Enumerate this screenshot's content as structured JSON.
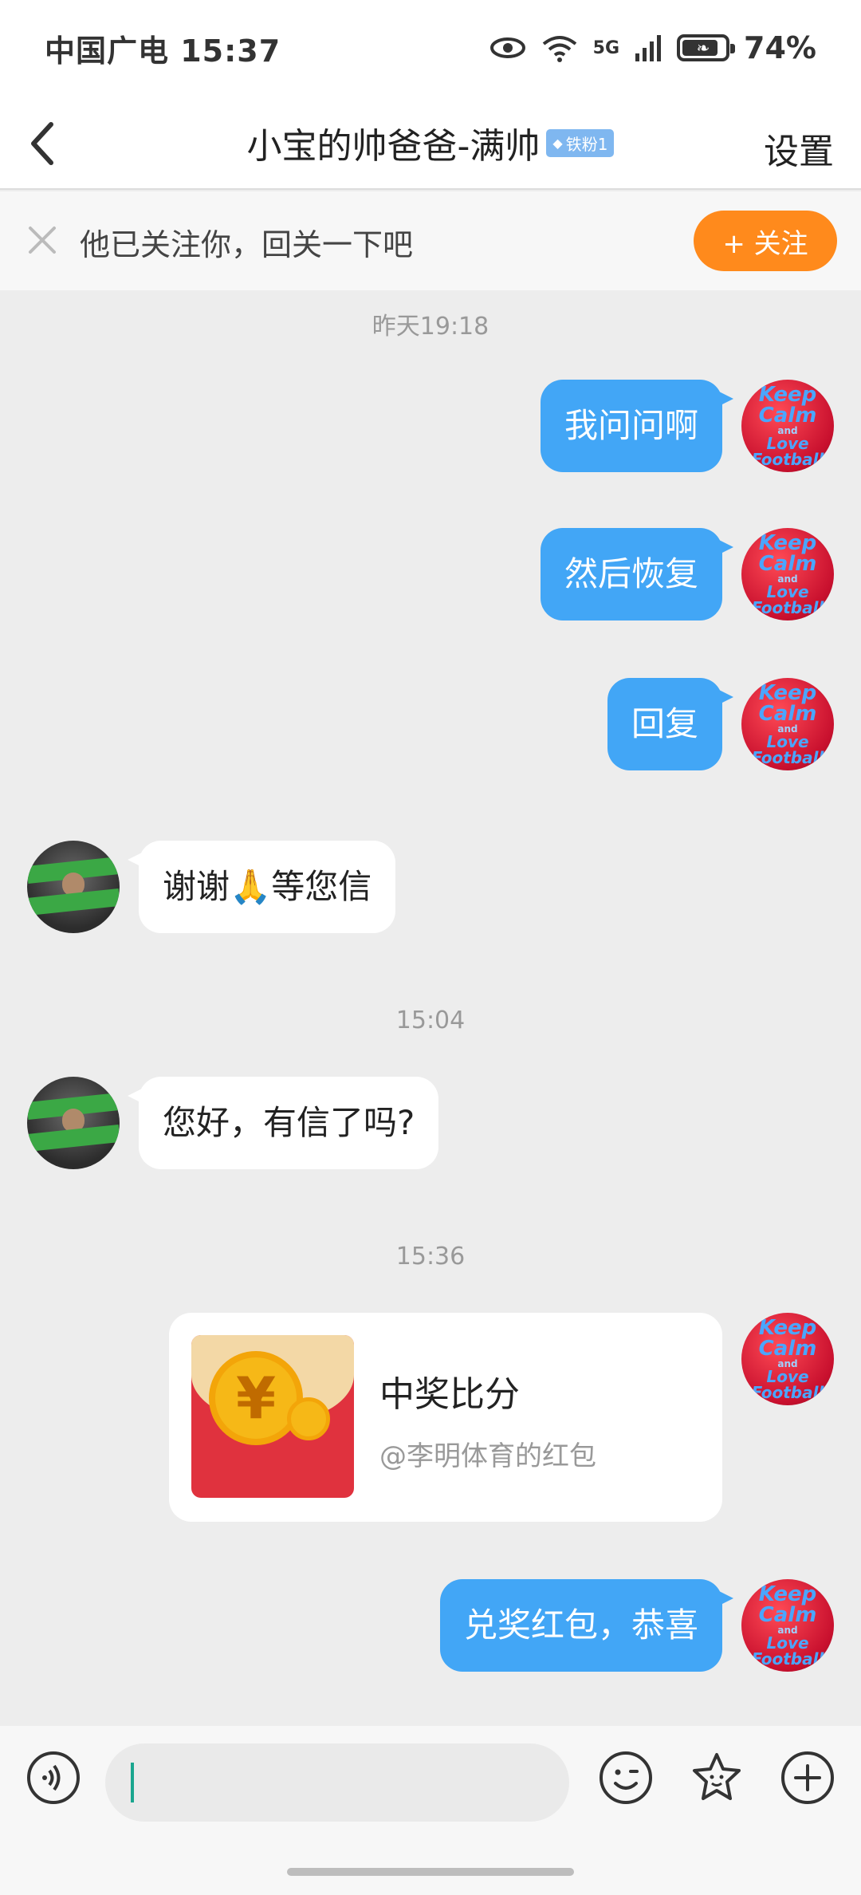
{
  "status_bar": {
    "carrier": "中国广电 15:37",
    "battery": "74%",
    "signal_label": "5G"
  },
  "header": {
    "title": "小宝的帅爸爸-满帅",
    "badge": "铁粉1",
    "settings_label": "设置"
  },
  "follow_prompt": {
    "text": "他已关注你，回关一下吧",
    "button_label": "+ 关注"
  },
  "avatars": {
    "self_text_line1": "Keep",
    "self_text_line2": "Calm",
    "self_text_line3": "and",
    "self_text_line4": "Love",
    "self_text_line5": "Football"
  },
  "messages": [
    {
      "type": "timestamp",
      "text": "昨天19:18"
    },
    {
      "type": "text",
      "direction": "out",
      "text": "我问问啊"
    },
    {
      "type": "text",
      "direction": "out",
      "text": "然后恢复"
    },
    {
      "type": "text",
      "direction": "out",
      "text": "回复"
    },
    {
      "type": "text",
      "direction": "in",
      "text": "谢谢🙏等您信"
    },
    {
      "type": "timestamp",
      "text": "15:04"
    },
    {
      "type": "text",
      "direction": "in",
      "text": "您好，有信了吗?"
    },
    {
      "type": "timestamp",
      "text": "15:36"
    },
    {
      "type": "red_packet",
      "direction": "out",
      "title": "中奖比分",
      "subtitle": "@李明体育的红包"
    },
    {
      "type": "text",
      "direction": "out",
      "text": "兑奖红包，恭喜"
    }
  ],
  "input_bar": {
    "value": "",
    "icons": [
      "voice-icon",
      "emoji-icon",
      "sticker-icon",
      "add-icon"
    ]
  },
  "colors": {
    "outgoing_bubble": "#42a6f6",
    "incoming_bubble": "#ffffff",
    "follow_button": "#ff8a1c",
    "background": "#ededed"
  }
}
